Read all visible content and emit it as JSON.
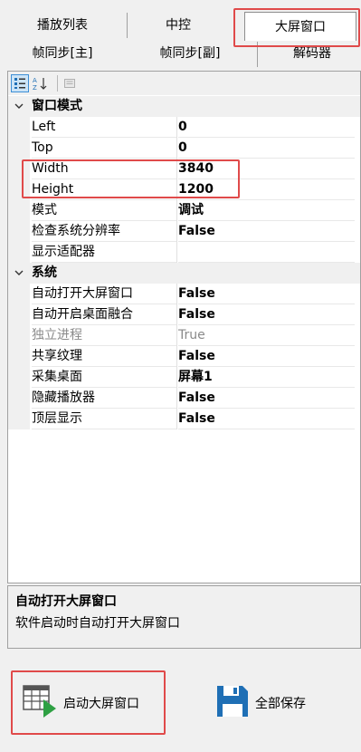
{
  "tabs": {
    "row1": [
      "播放列表",
      "中控",
      "大屏窗口"
    ],
    "row2": [
      "帧同步[主]",
      "帧同步[副]",
      "解码器"
    ],
    "active": "大屏窗口"
  },
  "toolbar": {
    "categorized_icon": "categorized-view-icon",
    "alphabetical_icon": "alphabetical-sort-icon",
    "pages_icon": "property-pages-icon"
  },
  "categories": [
    {
      "title": "窗口模式",
      "props": [
        {
          "name": "Left",
          "value": "0"
        },
        {
          "name": "Top",
          "value": "0"
        },
        {
          "name": "Width",
          "value": "3840"
        },
        {
          "name": "Height",
          "value": "1200"
        },
        {
          "name": "模式",
          "value": "调试"
        },
        {
          "name": "检查系统分辨率",
          "value": "False"
        },
        {
          "name": "显示适配器",
          "value": ""
        }
      ]
    },
    {
      "title": "系统",
      "props": [
        {
          "name": "自动打开大屏窗口",
          "value": "False"
        },
        {
          "name": "自动开启桌面融合",
          "value": "False"
        },
        {
          "name": "独立进程",
          "value": "True",
          "disabled": true
        },
        {
          "name": "共享纹理",
          "value": "False"
        },
        {
          "name": "采集桌面",
          "value": "屏幕1"
        },
        {
          "name": "隐藏播放器",
          "value": "False"
        },
        {
          "name": "顶层显示",
          "value": "False"
        }
      ]
    }
  ],
  "description": {
    "title": "自动打开大屏窗口",
    "text": "软件启动时自动打开大屏窗口"
  },
  "buttons": {
    "launch_label": "启动大屏窗口",
    "save_label": "全部保存"
  },
  "colors": {
    "highlight": "#e04a4a",
    "accent": "#1f6fb5",
    "play_green": "#2ea043"
  }
}
